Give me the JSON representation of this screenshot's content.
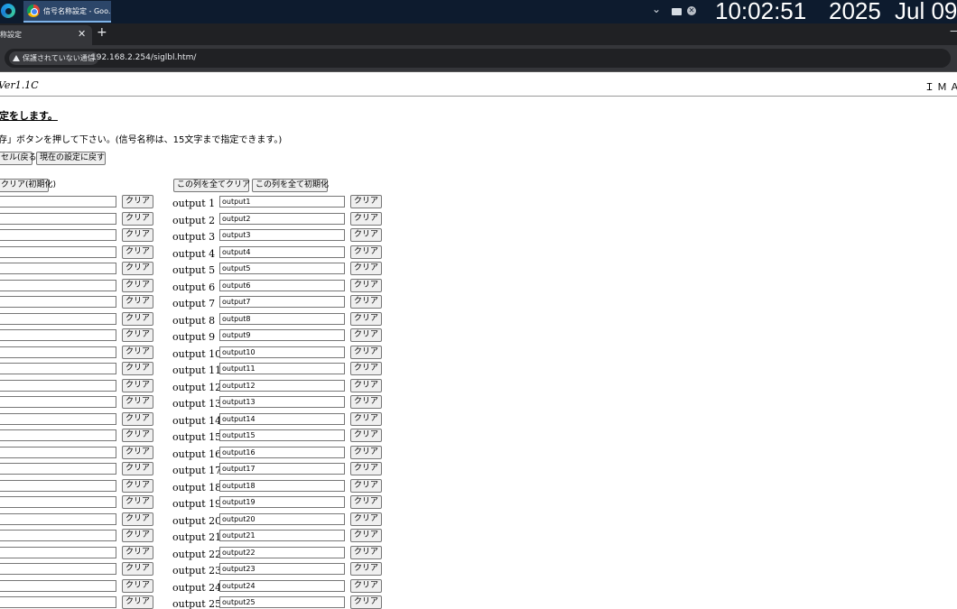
{
  "taskbar": {
    "app_label": "信号名称設定 - Goo...",
    "clock_time": "10:02:51",
    "clock_year": "2025",
    "clock_date": "Jul 09"
  },
  "browser": {
    "tab_title": "称設定",
    "security_label": "保護されていない通信",
    "url": "192.168.2.254/siglbl.htm/"
  },
  "page": {
    "version": "Ver1.1C",
    "brand": "ＩＭＡＧ",
    "heading": "定をします。",
    "instruction": "存」ボタンを押して下さい。(信号名称は、15文字まで指定できます。)",
    "cancel_label": "セル(戻る)",
    "restore_label": "現在の設定に戻す",
    "left_init_label": "クリア(初期化)",
    "col_clear_all_label": "この列を全てクリア",
    "col_init_all_label": "この列を全て初期化",
    "clear_label": "クリア"
  },
  "outputs": [
    {
      "label": "output 1",
      "value": "output1"
    },
    {
      "label": "output 2",
      "value": "output2"
    },
    {
      "label": "output 3",
      "value": "output3"
    },
    {
      "label": "output 4",
      "value": "output4"
    },
    {
      "label": "output 5",
      "value": "output5"
    },
    {
      "label": "output 6",
      "value": "output6"
    },
    {
      "label": "output 7",
      "value": "output7"
    },
    {
      "label": "output 8",
      "value": "output8"
    },
    {
      "label": "output 9",
      "value": "output9"
    },
    {
      "label": "output 10",
      "value": "output10"
    },
    {
      "label": "output 11",
      "value": "output11"
    },
    {
      "label": "output 12",
      "value": "output12"
    },
    {
      "label": "output 13",
      "value": "output13"
    },
    {
      "label": "output 14",
      "value": "output14"
    },
    {
      "label": "output 15",
      "value": "output15"
    },
    {
      "label": "output 16",
      "value": "output16"
    },
    {
      "label": "output 17",
      "value": "output17"
    },
    {
      "label": "output 18",
      "value": "output18"
    },
    {
      "label": "output 19",
      "value": "output19"
    },
    {
      "label": "output 20",
      "value": "output20"
    },
    {
      "label": "output 21",
      "value": "output21"
    },
    {
      "label": "output 22",
      "value": "output22"
    },
    {
      "label": "output 23",
      "value": "output23"
    },
    {
      "label": "output 24",
      "value": "output24"
    },
    {
      "label": "output 25",
      "value": "output25"
    }
  ]
}
